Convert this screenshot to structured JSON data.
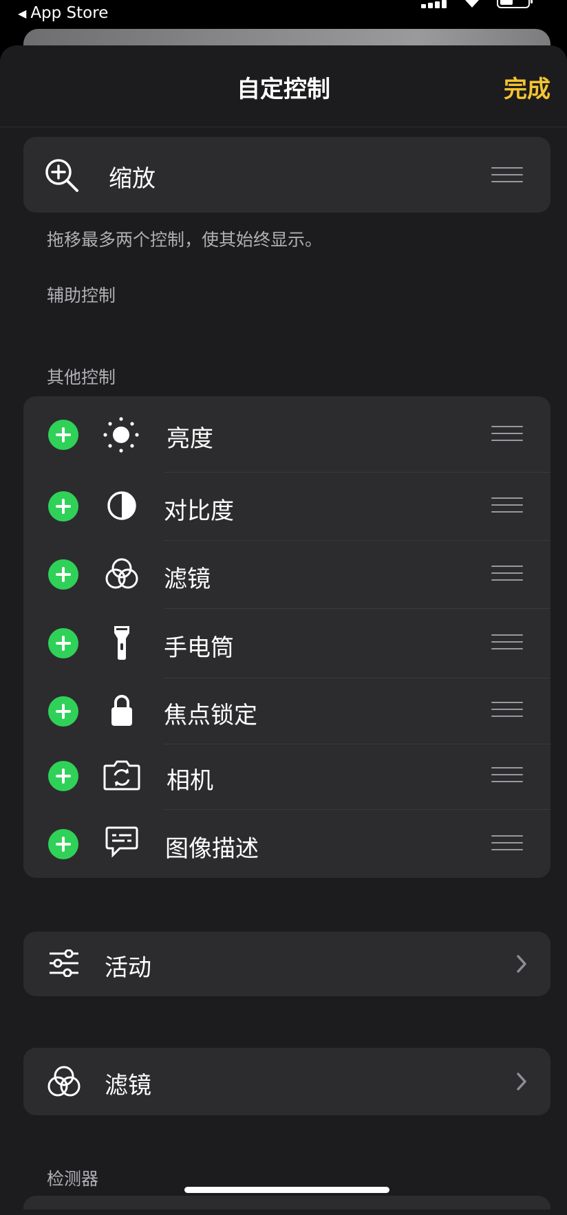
{
  "status_bar": {
    "back_label": "App Store"
  },
  "nav": {
    "title": "自定控制",
    "done_label": "完成"
  },
  "pinned": {
    "label": "缩放",
    "icon": "zoom-in-icon"
  },
  "hint": "拖移最多两个控制，使其始终显示。",
  "sections": {
    "assistive": "辅助控制",
    "other": "其他控制",
    "detectors": "检测器"
  },
  "other_controls": [
    {
      "label": "亮度",
      "icon": "brightness-icon"
    },
    {
      "label": "对比度",
      "icon": "contrast-icon"
    },
    {
      "label": "滤镜",
      "icon": "filters-icon"
    },
    {
      "label": "手电筒",
      "icon": "flashlight-icon"
    },
    {
      "label": "焦点锁定",
      "icon": "lock-icon"
    },
    {
      "label": "相机",
      "icon": "camera-switch-icon"
    },
    {
      "label": "图像描述",
      "icon": "message-icon"
    }
  ],
  "nav_rows": [
    {
      "label": "活动",
      "icon": "sliders-icon"
    },
    {
      "label": "滤镜",
      "icon": "filters-icon"
    }
  ],
  "colors": {
    "accent": "#f4c430",
    "add": "#30d158",
    "card": "#2c2c2e",
    "sheet": "#1c1c1e"
  }
}
